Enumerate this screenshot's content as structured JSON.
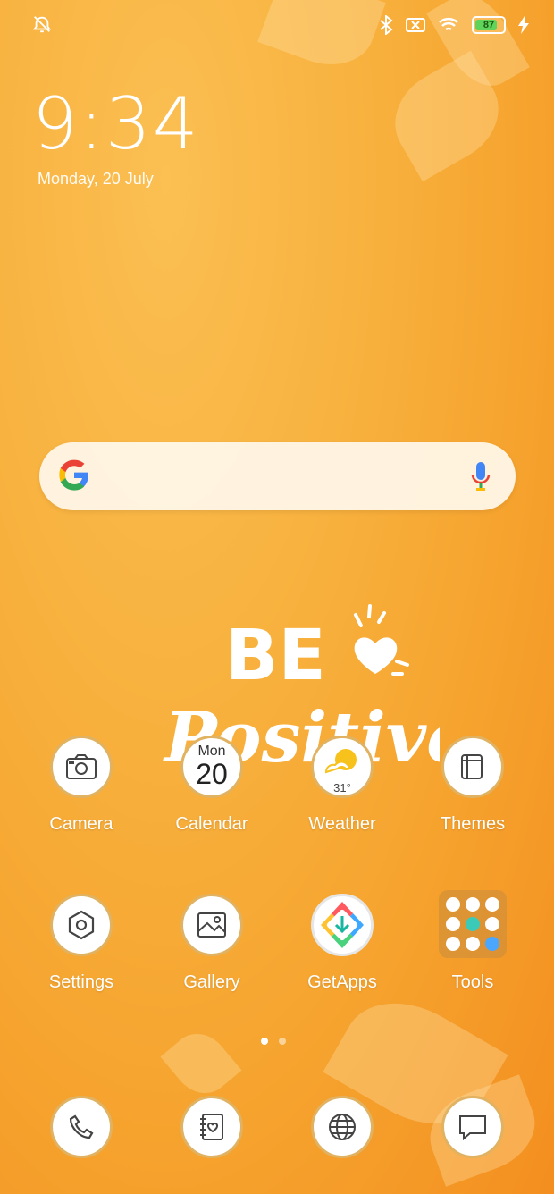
{
  "status_bar": {
    "left_icon": "alarm-off-icon",
    "right_icons": [
      "bluetooth-icon",
      "no-sim-icon",
      "wifi-icon",
      "battery-icon",
      "charging-icon"
    ],
    "battery_level": "87"
  },
  "lockclock": {
    "time": "9:34",
    "date": "Monday, 20 July"
  },
  "search_bar": {
    "logo": "google-logo-icon",
    "mic": "mic-icon"
  },
  "hero_text": {
    "line1": "BE",
    "line2": "Positive"
  },
  "apps_row1": [
    {
      "label": "Camera",
      "icon": "camera-icon"
    },
    {
      "label": "Calendar",
      "weekday": "Mon",
      "day": "20"
    },
    {
      "label": "Weather",
      "temp": "31°",
      "icon": "sun-cloud-icon"
    },
    {
      "label": "Themes",
      "icon": "themes-icon"
    }
  ],
  "apps_row2": [
    {
      "label": "Settings",
      "icon": "gear-icon"
    },
    {
      "label": "Gallery",
      "icon": "gallery-icon"
    },
    {
      "label": "GetApps",
      "icon": "getapps-icon"
    },
    {
      "label": "Tools",
      "icon": "folder-icon"
    }
  ],
  "page_indicator": {
    "current": 1,
    "total": 2
  },
  "dock": [
    {
      "icon": "phone-icon"
    },
    {
      "icon": "contacts-icon"
    },
    {
      "icon": "browser-icon"
    },
    {
      "icon": "messages-icon"
    }
  ],
  "colors": {
    "background": "#f8b23f",
    "battery": "#5fd35a",
    "icon_border": "#e0b262"
  }
}
